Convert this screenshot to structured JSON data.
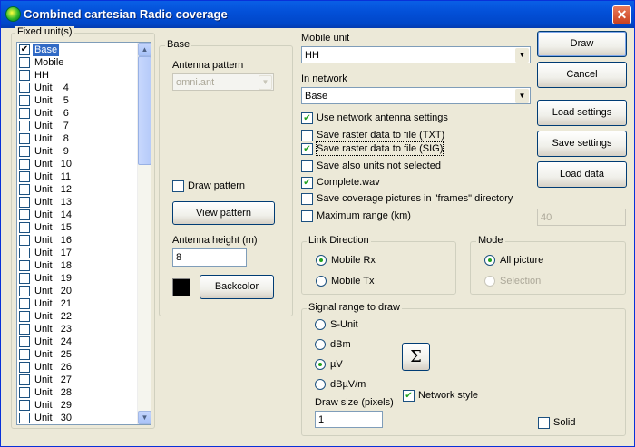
{
  "window": {
    "title": "Combined cartesian Radio coverage",
    "close_glyph": "✕"
  },
  "fixed_units": {
    "label": "Fixed unit(s)",
    "items": [
      {
        "label": "Base",
        "checked": true
      },
      {
        "label": "Mobile"
      },
      {
        "label": "HH"
      },
      {
        "label": "Unit    4"
      },
      {
        "label": "Unit    5"
      },
      {
        "label": "Unit    6"
      },
      {
        "label": "Unit    7"
      },
      {
        "label": "Unit    8"
      },
      {
        "label": "Unit    9"
      },
      {
        "label": "Unit   10"
      },
      {
        "label": "Unit   11"
      },
      {
        "label": "Unit   12"
      },
      {
        "label": "Unit   13"
      },
      {
        "label": "Unit   14"
      },
      {
        "label": "Unit   15"
      },
      {
        "label": "Unit   16"
      },
      {
        "label": "Unit   17"
      },
      {
        "label": "Unit   18"
      },
      {
        "label": "Unit   19"
      },
      {
        "label": "Unit   20"
      },
      {
        "label": "Unit   21"
      },
      {
        "label": "Unit   22"
      },
      {
        "label": "Unit   23"
      },
      {
        "label": "Unit   24"
      },
      {
        "label": "Unit   25"
      },
      {
        "label": "Unit   26"
      },
      {
        "label": "Unit   27"
      },
      {
        "label": "Unit   28"
      },
      {
        "label": "Unit   29"
      },
      {
        "label": "Unit   30"
      }
    ]
  },
  "base_panel": {
    "label": "Base",
    "antenna_pattern_label": "Antenna pattern",
    "antenna_pattern_value": "omni.ant",
    "draw_pattern_label": "Draw pattern",
    "view_pattern_label": "View pattern",
    "antenna_height_label": "Antenna height (m)",
    "antenna_height_value": "8",
    "backcolor_label": "Backcolor",
    "backcolor_value": "#000000"
  },
  "mobile_unit": {
    "label": "Mobile unit",
    "value": "HH"
  },
  "in_network": {
    "label": "In network",
    "value": "Base"
  },
  "options": {
    "use_network_antenna": {
      "label": "Use network antenna settings",
      "checked": true
    },
    "save_raster_txt": {
      "label": "Save raster data to file (TXT)",
      "checked": false
    },
    "save_raster_sig": {
      "label": "Save raster data to file (SIG)",
      "checked": true
    },
    "save_units_not_selected": {
      "label": "Save also units not selected",
      "checked": false
    },
    "complete_wav": {
      "label": "Complete.wav",
      "checked": true
    },
    "save_coverage_frames": {
      "label": "Save coverage pictures in \"frames\" directory",
      "checked": false
    },
    "maximum_range": {
      "label": "Maximum range (km)",
      "checked": false,
      "value": "40"
    }
  },
  "buttons": {
    "draw": "Draw",
    "cancel": "Cancel",
    "load_settings": "Load settings",
    "save_settings": "Save settings",
    "load_data": "Load data"
  },
  "link_direction": {
    "label": "Link Direction",
    "mobile_rx": "Mobile Rx",
    "mobile_tx": "Mobile Tx",
    "selected": "Mobile Rx"
  },
  "mode": {
    "label": "Mode",
    "all_picture": "All picture",
    "selection": "Selection",
    "selected": "All picture"
  },
  "signal_range": {
    "label": "Signal range to draw",
    "s_unit": "S-Unit",
    "dbm": "dBm",
    "uv": "µV",
    "dbuvm": "dBµV/m",
    "selected": "µV",
    "sum_glyph": "Σ",
    "network_style_label": "Network style",
    "network_style_checked": true,
    "draw_size_label": "Draw size (pixels)",
    "draw_size_value": "1",
    "solid_label": "Solid",
    "solid_checked": false
  },
  "glyphs": {
    "check": "✔",
    "scroll_up": "▲",
    "scroll_down": "▼",
    "dropdown": "▼"
  }
}
